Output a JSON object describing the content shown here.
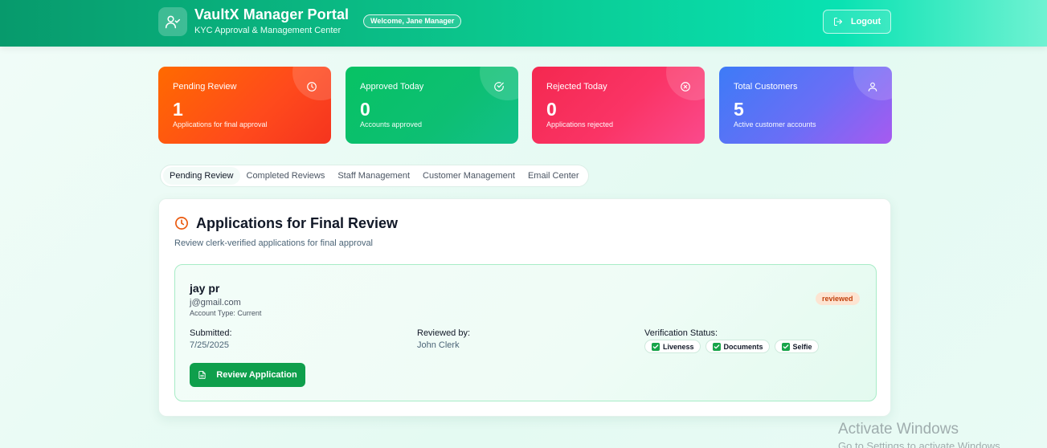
{
  "header": {
    "title": "VaultX Manager Portal",
    "subtitle": "KYC Approval & Management Center",
    "welcome": "Welcome, Jane Manager",
    "logout_label": "Logout",
    "logo_icon": "user-check-icon",
    "logout_icon": "logout-icon"
  },
  "stats": [
    {
      "label": "Pending Review",
      "value": "1",
      "description": "Applications for final approval",
      "icon": "clock-icon",
      "color": "#ff5a10"
    },
    {
      "label": "Approved Today",
      "value": "0",
      "description": "Accounts approved",
      "icon": "check-circle-icon",
      "color": "#0bc06c"
    },
    {
      "label": "Rejected Today",
      "value": "0",
      "description": "Applications rejected",
      "icon": "x-circle-icon",
      "color": "#f63060"
    },
    {
      "label": "Total Customers",
      "value": "5",
      "description": "Active customer accounts",
      "icon": "user-icon",
      "color": "#6a6ef6"
    }
  ],
  "tabs": [
    {
      "label": "Pending Review",
      "active": true
    },
    {
      "label": "Completed Reviews",
      "active": false
    },
    {
      "label": "Staff Management",
      "active": false
    },
    {
      "label": "Customer Management",
      "active": false
    },
    {
      "label": "Email Center",
      "active": false
    }
  ],
  "panel": {
    "title": "Applications for Final Review",
    "subtitle": "Review clerk-verified applications for final approval",
    "icon": "clock-icon"
  },
  "application": {
    "name": "jay pr",
    "email": "j@gmail.com",
    "account_type": "Account Type: Current",
    "status": "reviewed",
    "submitted_label": "Submitted:",
    "submitted_value": "7/25/2025",
    "reviewed_by_label": "Reviewed by:",
    "reviewed_by_value": "John Clerk",
    "verification_label": "Verification Status:",
    "checks": [
      "Liveness",
      "Documents",
      "Selfie"
    ],
    "review_button": "Review Application",
    "review_icon": "document-icon"
  },
  "watermark": {
    "title": "Activate Windows",
    "subtitle": "Go to Settings to activate Windows."
  },
  "colors": {
    "accent": "#0bc58c",
    "button": "#0f9f4c",
    "status_pill_bg": "#fde4d2",
    "status_pill_text": "#c2410c"
  }
}
